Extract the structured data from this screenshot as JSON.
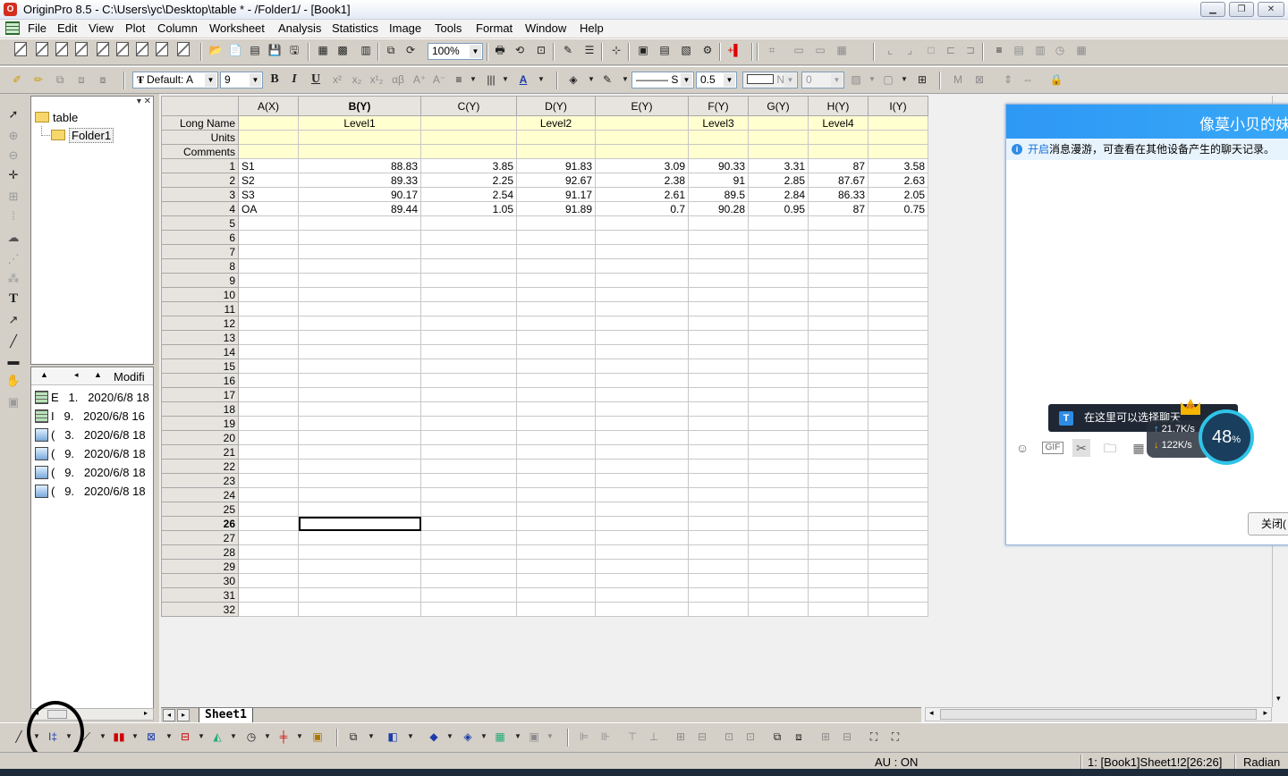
{
  "window": {
    "title": "OriginPro 8.5 - C:\\Users\\yc\\Desktop\\table * - /Folder1/ - [Book1]",
    "app_icon": "origin-logo-icon",
    "controls": [
      "minimize-icon",
      "restore-icon",
      "close-icon"
    ]
  },
  "menu": [
    "File",
    "Edit",
    "View",
    "Plot",
    "Column",
    "Worksheet",
    "Analysis",
    "Statistics",
    "Image",
    "Tools",
    "Format",
    "Window",
    "Help"
  ],
  "toolbar1": {
    "zoom": "100%"
  },
  "toolbar2": {
    "font_name": "Default: A",
    "font_size": "9",
    "bold": "B",
    "italic": "I",
    "underline": "U",
    "line_style": "S",
    "line_width": "0.5",
    "pattern": "N",
    "pattern_value": "0"
  },
  "explorer": {
    "root": "table",
    "child": "Folder1",
    "list_header": "Modifi",
    "items": [
      {
        "type": "workbook",
        "col1": "E",
        "num": "1.",
        "date": "2020/6/8 18"
      },
      {
        "type": "workbook",
        "col1": "I",
        "num": "9.",
        "date": "2020/6/8 16"
      },
      {
        "type": "graph",
        "col1": "(",
        "num": "3.",
        "date": "2020/6/8 18"
      },
      {
        "type": "graph",
        "col1": "(",
        "num": "9.",
        "date": "2020/6/8 18"
      },
      {
        "type": "graph",
        "col1": "(",
        "num": "9.",
        "date": "2020/6/8 18"
      },
      {
        "type": "graph",
        "col1": "(",
        "num": "9.",
        "date": "2020/6/8 18"
      }
    ]
  },
  "worksheet": {
    "columns": [
      "A(X)",
      "B(Y)",
      "C(Y)",
      "D(Y)",
      "E(Y)",
      "F(Y)",
      "G(Y)",
      "H(Y)",
      "I(Y)"
    ],
    "row_labels": {
      "long_name": "Long Name",
      "units": "Units",
      "comments": "Comments"
    },
    "long_names": [
      "",
      "Level1",
      "",
      "Level2",
      "",
      "Level3",
      "",
      "Level4",
      ""
    ],
    "data": [
      [
        "S1",
        "88.83",
        "3.85",
        "91.83",
        "3.09",
        "90.33",
        "3.31",
        "87",
        "3.58"
      ],
      [
        "S2",
        "89.33",
        "2.25",
        "92.67",
        "2.38",
        "91",
        "2.85",
        "87.67",
        "2.63"
      ],
      [
        "S3",
        "90.17",
        "2.54",
        "91.17",
        "2.61",
        "89.5",
        "2.84",
        "86.33",
        "2.05"
      ],
      [
        "OA",
        "89.44",
        "1.05",
        "91.89",
        "0.7",
        "90.28",
        "0.95",
        "87",
        "0.75"
      ]
    ],
    "total_rows": 32,
    "active_row": 26,
    "sheet_tab": "Sheet1"
  },
  "chat": {
    "name": "像莫小贝的妹",
    "notice_link": "开启",
    "notice_text": "消息漫游，可查看在其他设备产生的聊天记录。",
    "tip": "在这里可以选择聊天",
    "close_label": "关闭(",
    "upload": "21.7K/s",
    "download": "122K/s",
    "percent": "48",
    "percent_sign": "%"
  },
  "status": {
    "au": "AU : ON",
    "cell": "1: [Book1]Sheet1!2[26:26]",
    "angle": "Radian"
  }
}
